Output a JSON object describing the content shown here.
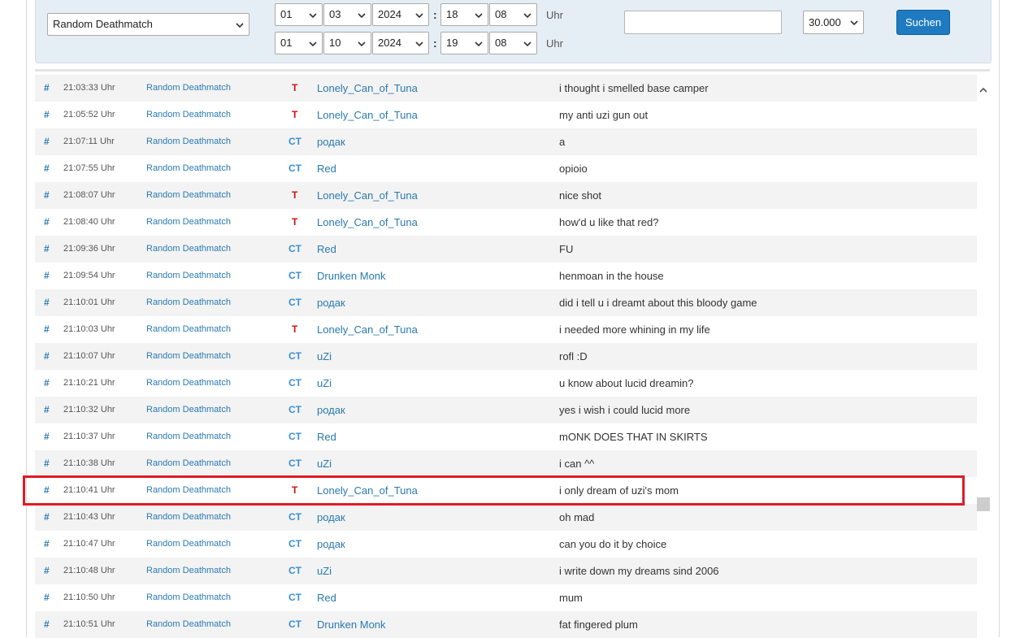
{
  "filters": {
    "server_select": "Random Deathmatch",
    "from": {
      "day": "01",
      "month": "03",
      "year": "2024",
      "hour": "18",
      "minute": "08"
    },
    "to": {
      "day": "01",
      "month": "10",
      "year": "2024",
      "hour": "19",
      "minute": "08"
    },
    "uhr_label": "Uhr",
    "colon": ":",
    "search_text": "",
    "limit": "30.000",
    "search_button": "Suchen"
  },
  "rows": [
    {
      "hash": "#",
      "time": "21:03:33 Uhr",
      "map": "Random Deathmatch",
      "team": "T",
      "player": "Lonely_Can_of_Tuna",
      "message": "i thought i smelled base camper"
    },
    {
      "hash": "#",
      "time": "21:05:52 Uhr",
      "map": "Random Deathmatch",
      "team": "T",
      "player": "Lonely_Can_of_Tuna",
      "message": "my anti uzi gun out"
    },
    {
      "hash": "#",
      "time": "21:07:11 Uhr",
      "map": "Random Deathmatch",
      "team": "CT",
      "player": "родак",
      "message": "a"
    },
    {
      "hash": "#",
      "time": "21:07:55 Uhr",
      "map": "Random Deathmatch",
      "team": "CT",
      "player": "Red",
      "message": "opioio"
    },
    {
      "hash": "#",
      "time": "21:08:07 Uhr",
      "map": "Random Deathmatch",
      "team": "T",
      "player": "Lonely_Can_of_Tuna",
      "message": "nice shot"
    },
    {
      "hash": "#",
      "time": "21:08:40 Uhr",
      "map": "Random Deathmatch",
      "team": "T",
      "player": "Lonely_Can_of_Tuna",
      "message": "how'd u like that red?"
    },
    {
      "hash": "#",
      "time": "21:09:36 Uhr",
      "map": "Random Deathmatch",
      "team": "CT",
      "player": "Red",
      "message": "FU"
    },
    {
      "hash": "#",
      "time": "21:09:54 Uhr",
      "map": "Random Deathmatch",
      "team": "CT",
      "player": "Drunken Monk",
      "message": "henmoan in the house"
    },
    {
      "hash": "#",
      "time": "21:10:01 Uhr",
      "map": "Random Deathmatch",
      "team": "CT",
      "player": "родак",
      "message": "did i tell u i dreamt about this bloody game"
    },
    {
      "hash": "#",
      "time": "21:10:03 Uhr",
      "map": "Random Deathmatch",
      "team": "T",
      "player": "Lonely_Can_of_Tuna",
      "message": "i needed more whining in my life"
    },
    {
      "hash": "#",
      "time": "21:10:07 Uhr",
      "map": "Random Deathmatch",
      "team": "CT",
      "player": "uZi",
      "message": "rofl :D"
    },
    {
      "hash": "#",
      "time": "21:10:21 Uhr",
      "map": "Random Deathmatch",
      "team": "CT",
      "player": "uZi",
      "message": "u know about lucid dreamin?"
    },
    {
      "hash": "#",
      "time": "21:10:32 Uhr",
      "map": "Random Deathmatch",
      "team": "CT",
      "player": "родак",
      "message": "yes i wish i could lucid more"
    },
    {
      "hash": "#",
      "time": "21:10:37 Uhr",
      "map": "Random Deathmatch",
      "team": "CT",
      "player": "Red",
      "message": "mONK DOES THAT IN SKIRTS"
    },
    {
      "hash": "#",
      "time": "21:10:38 Uhr",
      "map": "Random Deathmatch",
      "team": "CT",
      "player": "uZi",
      "message": "i can ^^"
    },
    {
      "hash": "#",
      "time": "21:10:41 Uhr",
      "map": "Random Deathmatch",
      "team": "T",
      "player": "Lonely_Can_of_Tuna",
      "message": "i only dream of uzi's mom",
      "highlighted": true
    },
    {
      "hash": "#",
      "time": "21:10:43 Uhr",
      "map": "Random Deathmatch",
      "team": "CT",
      "player": "родак",
      "message": "oh mad"
    },
    {
      "hash": "#",
      "time": "21:10:47 Uhr",
      "map": "Random Deathmatch",
      "team": "CT",
      "player": "родак",
      "message": "can you do it by choice"
    },
    {
      "hash": "#",
      "time": "21:10:48 Uhr",
      "map": "Random Deathmatch",
      "team": "CT",
      "player": "uZi",
      "message": "i write down my dreams sind 2006"
    },
    {
      "hash": "#",
      "time": "21:10:50 Uhr",
      "map": "Random Deathmatch",
      "team": "CT",
      "player": "Red",
      "message": "mum"
    },
    {
      "hash": "#",
      "time": "21:10:51 Uhr",
      "map": "Random Deathmatch",
      "team": "CT",
      "player": "Drunken Monk",
      "message": "fat fingered plum"
    }
  ],
  "colors": {
    "team_T": "#cc1111",
    "team_CT": "#3a8fd6",
    "link": "#2a7ab0",
    "highlight": "#e01b24",
    "button": "#1f7bc1"
  }
}
